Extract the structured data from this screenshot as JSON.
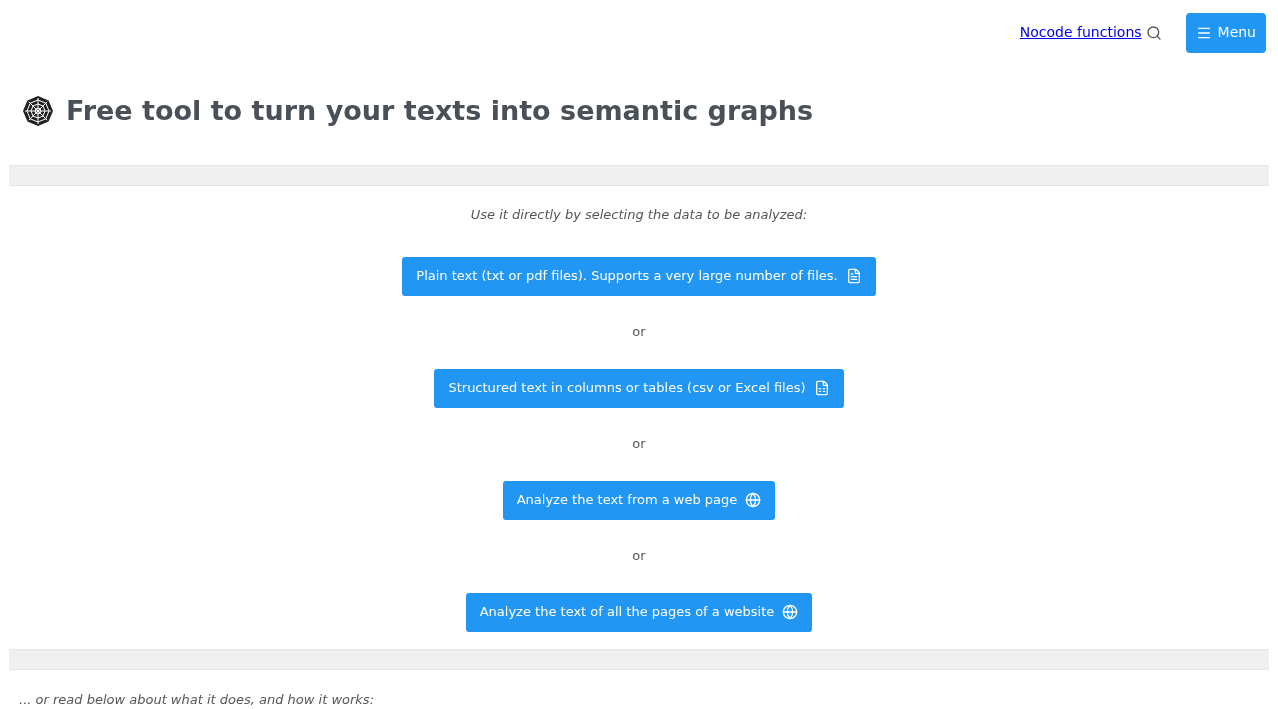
{
  "nav": {
    "link": "Nocode functions",
    "menu_button": "Menu"
  },
  "title": "Free tool to turn your texts into semantic graphs",
  "intro": "Use it directly by selecting the data to be analyzed:",
  "choices": [
    {
      "kind": "pdf",
      "label": "Plain text (txt or pdf files). Supports a very large number of files."
    },
    {
      "kind": "separator",
      "label": "or"
    },
    {
      "kind": "spreadsheet",
      "label": "Structured text in columns or tables (csv or Excel files)"
    },
    {
      "kind": "separator",
      "label": "or"
    },
    {
      "kind": "web",
      "label": "Analyze the text from a web page"
    },
    {
      "kind": "separator",
      "label": "or"
    },
    {
      "kind": "web",
      "label": "Analyze the text of all the pages of a website"
    }
  ],
  "footer_text": "... or read below about what it does, and how it works:"
}
